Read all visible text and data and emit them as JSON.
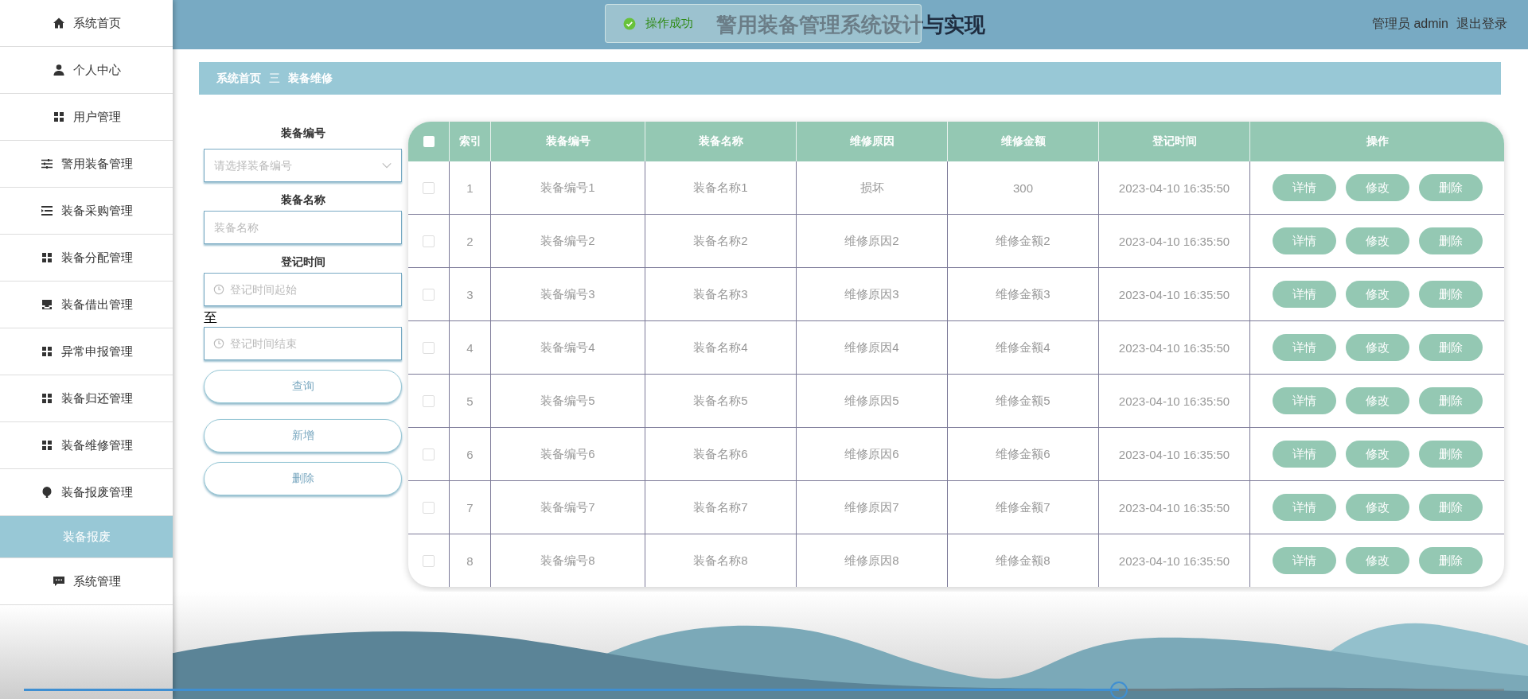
{
  "sidebar": {
    "items": [
      {
        "label": "系统首页",
        "kind": "home",
        "selected": false
      },
      {
        "label": "个人中心",
        "kind": "user",
        "selected": false
      },
      {
        "label": "用户管理",
        "kind": "grid",
        "selected": false
      },
      {
        "label": "警用装备管理",
        "kind": "sliders",
        "selected": false
      },
      {
        "label": "装备采购管理",
        "kind": "list",
        "selected": false
      },
      {
        "label": "装备分配管理",
        "kind": "grid",
        "selected": false
      },
      {
        "label": "装备借出管理",
        "kind": "tray",
        "selected": false
      },
      {
        "label": "异常申报管理",
        "kind": "grid",
        "selected": false
      },
      {
        "label": "装备归还管理",
        "kind": "grid",
        "selected": false
      },
      {
        "label": "装备维修管理",
        "kind": "grid",
        "selected": false
      },
      {
        "label": "装备报废管理",
        "kind": "pin",
        "selected": false
      },
      {
        "label": "装备报废",
        "kind": "plain",
        "selected": true
      },
      {
        "label": "系统管理",
        "kind": "chat",
        "selected": false
      }
    ]
  },
  "header": {
    "title": "警用装备管理系统设计与实现",
    "user": "管理员 admin",
    "logout": "退出登录"
  },
  "toast": {
    "text": "操作成功"
  },
  "breadcrumb": {
    "home": "系统首页",
    "separator": "三",
    "current": "装备维修"
  },
  "filters": [
    {
      "label": "装备编号",
      "kind": "select",
      "placeholder": "请选择装备编号"
    },
    {
      "label": "装备名称",
      "kind": "text",
      "placeholder": "装备名称"
    },
    {
      "label": "登记时间",
      "kind": "date",
      "placeholder": "登记时间起始"
    },
    {
      "label": "至",
      "kind": "date_to",
      "placeholder": "登记时间结束"
    }
  ],
  "actions": [
    "查询",
    "新增",
    "删除"
  ],
  "table": {
    "header_checked": false,
    "columns": [
      "索引",
      "装备编号",
      "装备名称",
      "维修原因",
      "维修金额",
      "登记时间",
      "操作"
    ],
    "rows": [
      {
        "checked": false,
        "cells": [
          "1",
          "装备编号1",
          "装备名称1",
          "损坏",
          "300",
          "2023-04-10 16:35:50"
        ],
        "actions": [
          "详情",
          "修改",
          "删除"
        ]
      },
      {
        "checked": false,
        "cells": [
          "2",
          "装备编号2",
          "装备名称2",
          "维修原因2",
          "维修金额2",
          "2023-04-10 16:35:50"
        ],
        "actions": [
          "详情",
          "修改",
          "删除"
        ]
      },
      {
        "checked": false,
        "cells": [
          "3",
          "装备编号3",
          "装备名称3",
          "维修原因3",
          "维修金额3",
          "2023-04-10 16:35:50"
        ],
        "actions": [
          "详情",
          "修改",
          "删除"
        ]
      },
      {
        "checked": false,
        "cells": [
          "4",
          "装备编号4",
          "装备名称4",
          "维修原因4",
          "维修金额4",
          "2023-04-10 16:35:50"
        ],
        "actions": [
          "详情",
          "修改",
          "删除"
        ]
      },
      {
        "checked": false,
        "cells": [
          "5",
          "装备编号5",
          "装备名称5",
          "维修原因5",
          "维修金额5",
          "2023-04-10 16:35:50"
        ],
        "actions": [
          "详情",
          "修改",
          "删除"
        ]
      },
      {
        "checked": false,
        "cells": [
          "6",
          "装备编号6",
          "装备名称6",
          "维修原因6",
          "维修金额6",
          "2023-04-10 16:35:50"
        ],
        "actions": [
          "详情",
          "修改",
          "删除"
        ]
      },
      {
        "checked": false,
        "cells": [
          "7",
          "装备编号7",
          "装备名称7",
          "维修原因7",
          "维修金额7",
          "2023-04-10 16:35:50"
        ],
        "actions": [
          "详情",
          "修改",
          "删除"
        ]
      },
      {
        "checked": false,
        "cells": [
          "8",
          "装备编号8",
          "装备名称8",
          "维修原因8",
          "维修金额8",
          "2023-04-10 16:35:50"
        ],
        "actions": [
          "详情",
          "修改",
          "删除"
        ]
      }
    ]
  },
  "player": {
    "level": 0.74
  }
}
